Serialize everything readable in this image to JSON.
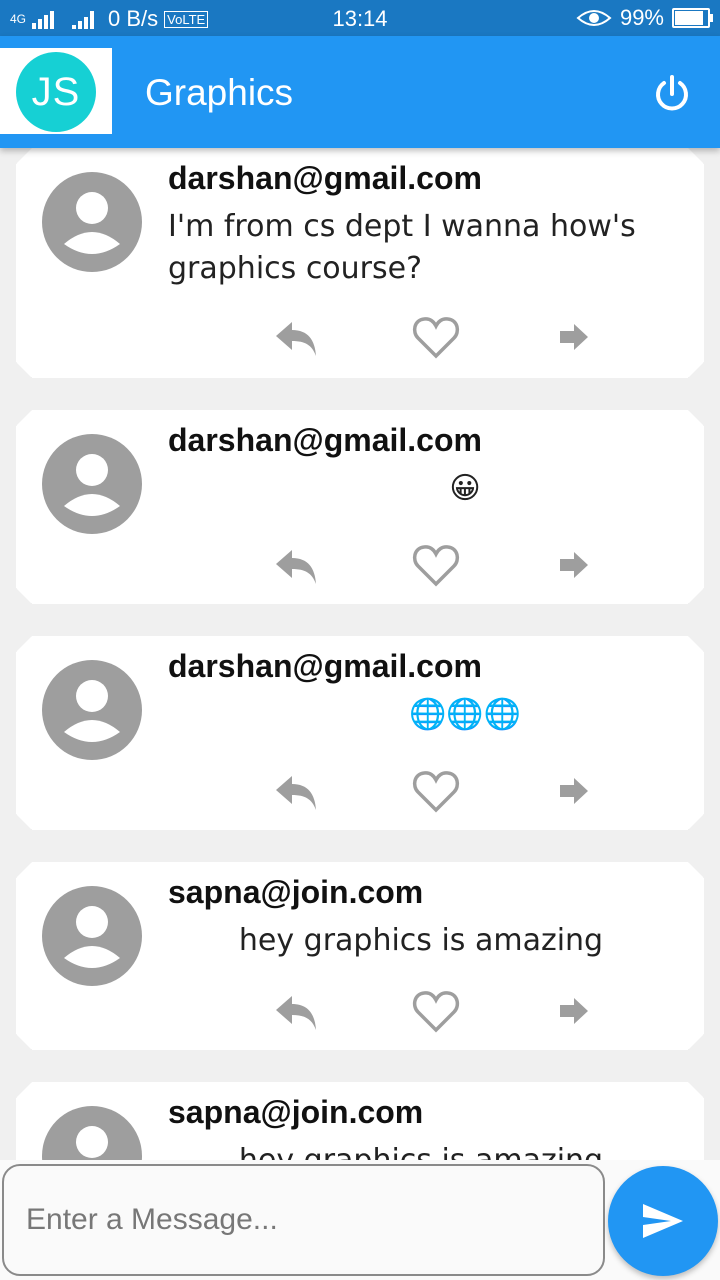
{
  "status_bar": {
    "network": "4G",
    "speed": "0 B/s",
    "volte": "VoLTE",
    "time": "13:14",
    "battery": "99%",
    "battery_level": 0.99
  },
  "app_bar": {
    "logo_text": "JS",
    "title": "Graphics",
    "power_icon": "power-icon",
    "color": "#2196f3"
  },
  "messages": [
    {
      "sender": "darshan@gmail.com",
      "text": "I'm from cs dept I wanna how's graphics course?"
    },
    {
      "sender": "darshan@gmail.com",
      "text": "😀"
    },
    {
      "sender": "darshan@gmail.com",
      "text": "🌐🌐🌐"
    },
    {
      "sender": "sapna@join.com",
      "text": "hey graphics is amazing"
    },
    {
      "sender": "sapna@join.com",
      "text": "hey graphics is amazing"
    }
  ],
  "composer": {
    "placeholder": "Enter a Message...",
    "send_icon": "send-icon"
  }
}
